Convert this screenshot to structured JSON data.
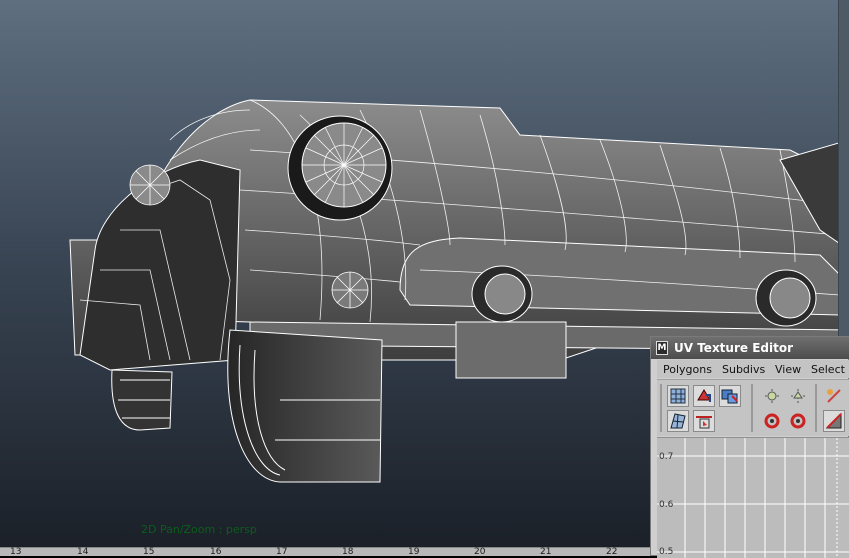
{
  "viewport": {
    "label": "2D Pan/Zoom : persp",
    "timeline_ticks": [
      "13",
      "14",
      "15",
      "16",
      "17",
      "18",
      "19",
      "20",
      "21",
      "22"
    ]
  },
  "uv_editor": {
    "title": "UV Texture Editor",
    "menu": [
      "Polygons",
      "Subdivs",
      "View",
      "Select"
    ],
    "axis_labels": [
      "0.7",
      "0.6",
      "0.5"
    ],
    "tools": [
      "uv-grid-icon",
      "uv-move-icon",
      "uv-select-icon",
      "uv-layout-icon",
      "uv-normalize-icon",
      "uv-flip-horizontal-icon",
      "uv-flip-vertical-icon",
      "uv-rotate-ccw-icon",
      "uv-rotate-cw-icon",
      "uv-cut-icon",
      "uv-sew-icon"
    ]
  },
  "colors": {
    "wireframe": "#ffffff",
    "label_green": "#0b5e1b",
    "viewport_top": "#5f6f80",
    "viewport_bottom": "#1a1f27"
  }
}
